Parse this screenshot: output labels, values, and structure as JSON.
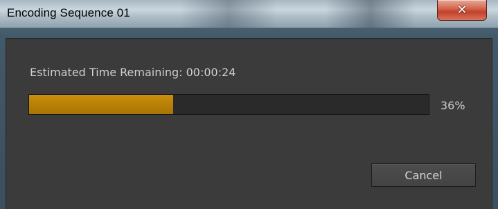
{
  "window": {
    "title": "Encoding Sequence 01",
    "close_icon": "close-icon"
  },
  "encoding": {
    "estimated_label": "Estimated Time Remaining: 00:00:24",
    "progress_fraction": 0.36,
    "percent_text": "36%",
    "accent_color": "#b88106"
  },
  "buttons": {
    "cancel_label": "Cancel"
  }
}
